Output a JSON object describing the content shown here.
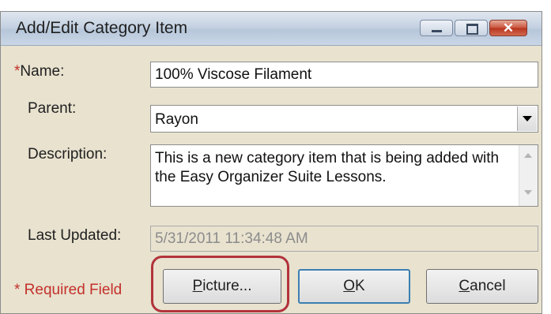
{
  "window": {
    "title": "Add/Edit Category Item",
    "close_glyph": "✕"
  },
  "form": {
    "name_asterisk": "*",
    "name_label": "Name:",
    "name_value": "100% Viscose Filament",
    "parent_label": "Parent:",
    "parent_value": "Rayon",
    "description_label": "Description:",
    "description_value": "This is a new category item that is being added with the Easy Organizer Suite Lessons.",
    "last_updated_label": "Last Updated:",
    "last_updated_value": "5/31/2011 11:34:48 AM",
    "required_note": "* Required Field"
  },
  "buttons": {
    "picture_first": "P",
    "picture_rest": "icture...",
    "ok_first": "O",
    "ok_rest": "K",
    "cancel_first": "C",
    "cancel_rest": "ancel"
  },
  "colors": {
    "required": "#c4302b",
    "highlight": "#b2333b",
    "dialog_bg": "#e8e2cf"
  }
}
